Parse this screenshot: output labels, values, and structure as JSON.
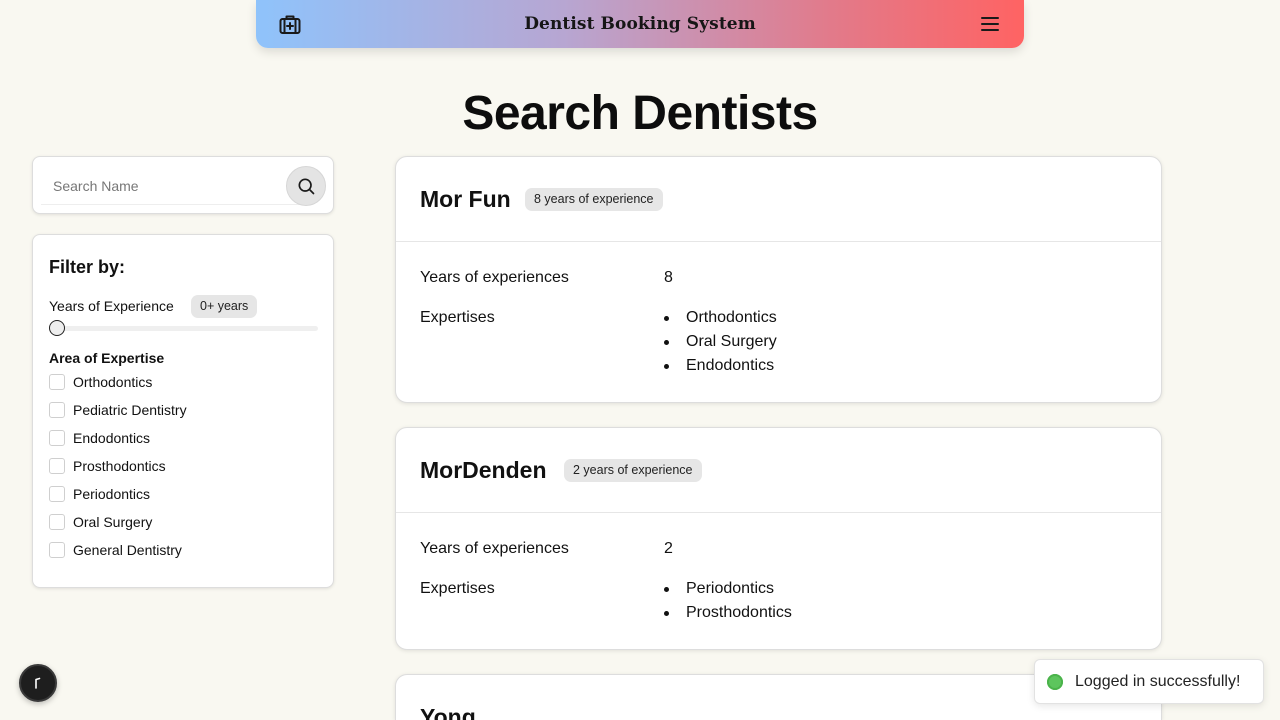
{
  "header": {
    "title": "Dentist Booking System",
    "brand_icon": "medical-kit-icon",
    "menu_icon": "hamburger-menu-icon",
    "gradient": [
      "#8fc3fb",
      "#ff6363"
    ]
  },
  "page": {
    "title": "Search Dentists"
  },
  "search": {
    "placeholder": "Search Name",
    "value": "",
    "button_icon": "search-icon"
  },
  "filters": {
    "title": "Filter by:",
    "experience": {
      "label": "Years of Experience",
      "badge": "0+ years",
      "slider_value": 0
    },
    "expertise": {
      "label": "Area of Expertise",
      "options": [
        {
          "label": "Orthodontics",
          "checked": false
        },
        {
          "label": "Pediatric Dentistry",
          "checked": false
        },
        {
          "label": "Endodontics",
          "checked": false
        },
        {
          "label": "Prosthodontics",
          "checked": false
        },
        {
          "label": "Periodontics",
          "checked": false
        },
        {
          "label": "Oral Surgery",
          "checked": false
        },
        {
          "label": "General Dentistry",
          "checked": false
        }
      ]
    }
  },
  "dentists": [
    {
      "name": "Mor Fun",
      "badge": "8 years of experience",
      "years_label": "Years of experiences",
      "years_value": "8",
      "expertise_label": "Expertises",
      "expertises": [
        "Orthodontics",
        "Oral Surgery",
        "Endodontics"
      ]
    },
    {
      "name": "MorDenden",
      "badge": "2 years of experience",
      "years_label": "Years of experiences",
      "years_value": "2",
      "expertise_label": "Expertises",
      "expertises": [
        "Periodontics",
        "Prosthodontics"
      ]
    },
    {
      "name": "Yong"
    }
  ],
  "toast": {
    "message": "Logged in successfully!",
    "status_color": "#5dc55d"
  },
  "fab": {
    "icon": "cursor-icon"
  }
}
